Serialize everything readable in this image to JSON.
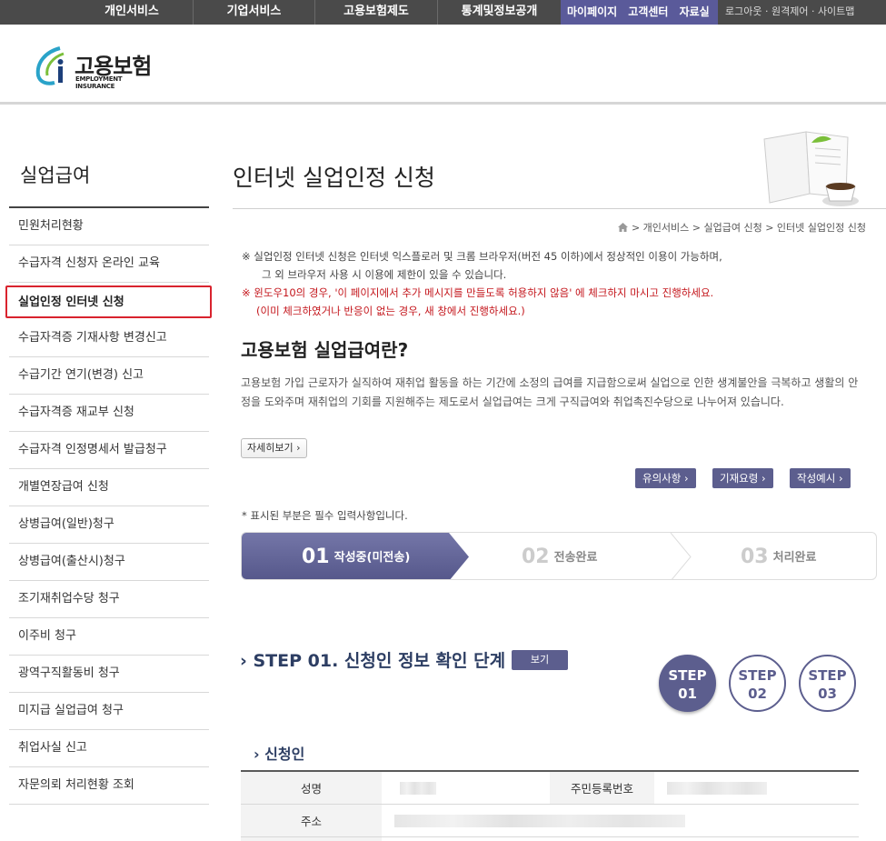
{
  "topnav": {
    "main_items": [
      "개인서비스",
      "기업서비스",
      "고용보험제도",
      "통계및정보공개"
    ],
    "purple_items": [
      "마이페이지",
      "고객센터",
      "자료실"
    ],
    "utils": "로그아웃 · 원격제어 · 사이트맵"
  },
  "logo": {
    "kor": "고용보험",
    "eng": "EMPLOYMENT INSURANCE"
  },
  "sidebar": {
    "title": "실업급여",
    "items": [
      "민원처리현황",
      "수급자격 신청자 온라인 교육",
      "실업인정 인터넷 신청",
      "수급자격증 기재사항 변경신고",
      "수급기간 연기(변경) 신고",
      "수급자격증 재교부 신청",
      "수급자격 인정명세서 발급청구",
      "개별연장급여 신청",
      "상병급여(일반)청구",
      "상병급여(출산시)청구",
      "조기재취업수당 청구",
      "이주비 청구",
      "광역구직활동비 청구",
      "미지급 실업급여 청구",
      "취업사실 신고",
      "자문의뢰 처리현황 조회"
    ]
  },
  "page": {
    "title": "인터넷 실업인정 신청",
    "breadcrumb": "> 개인서비스 > 실업급여 신청 > 인터넷 실업인정 신청",
    "notice1": "※ 실업인정 인터넷 신청은 인터넷 익스플로러 및 크롬 브라우저(버전 45 이하)에서 정상적인 이용이 가능하며,",
    "notice2": "그 외 브라우저 사용 시 이용에 제한이 있을 수 있습니다.",
    "notice3": "※ 윈도우10의 경우, '이 페이지에서 추가 메시지를 만들도록 허용하지 않음' 에 체크하지 마시고 진행하세요.",
    "notice4": "(이미 체크하였거나 반응이 없는 경우, 새 창에서 진행하세요.)",
    "section_heading": "고용보험 실업급여란?",
    "description": "고용보험 가입 근로자가 실직하여 재취업 활동을 하는 기간에 소정의 급여를 지급함으로써 실업으로 인한 생계불안을 극복하고 생활의 안정을 도와주며 재취업의 기회를 지원해주는 제도로서 실업급여는 크게 구직급여와 취업촉진수당으로 나누어져 있습니다.",
    "more_button": "자세히보기 ›",
    "buttons": [
      "유의사항 ›",
      "기재요령 ›",
      "작성예시 ›"
    ],
    "required_note": "* 표시된 부분은 필수 입력사항입니다."
  },
  "progress": [
    {
      "num": "01",
      "label": "작성중(미전송)"
    },
    {
      "num": "02",
      "label": "전송완료"
    },
    {
      "num": "03",
      "label": "처리완료"
    }
  ],
  "step": {
    "heading": "STEP 01. 신청인 정보 확인 단계",
    "view_button": "보기",
    "circles": [
      {
        "line1": "STEP",
        "line2": "01"
      },
      {
        "line1": "STEP",
        "line2": "02"
      },
      {
        "line1": "STEP",
        "line2": "03"
      }
    ]
  },
  "applicant": {
    "heading": "신청인",
    "name_label": "성명",
    "rrn_label": "주민등록번호",
    "address_label": "주소"
  },
  "colors": {
    "nav": "#4a4a4a",
    "accent": "#5c5e8e",
    "highlight": "#d9232e"
  }
}
